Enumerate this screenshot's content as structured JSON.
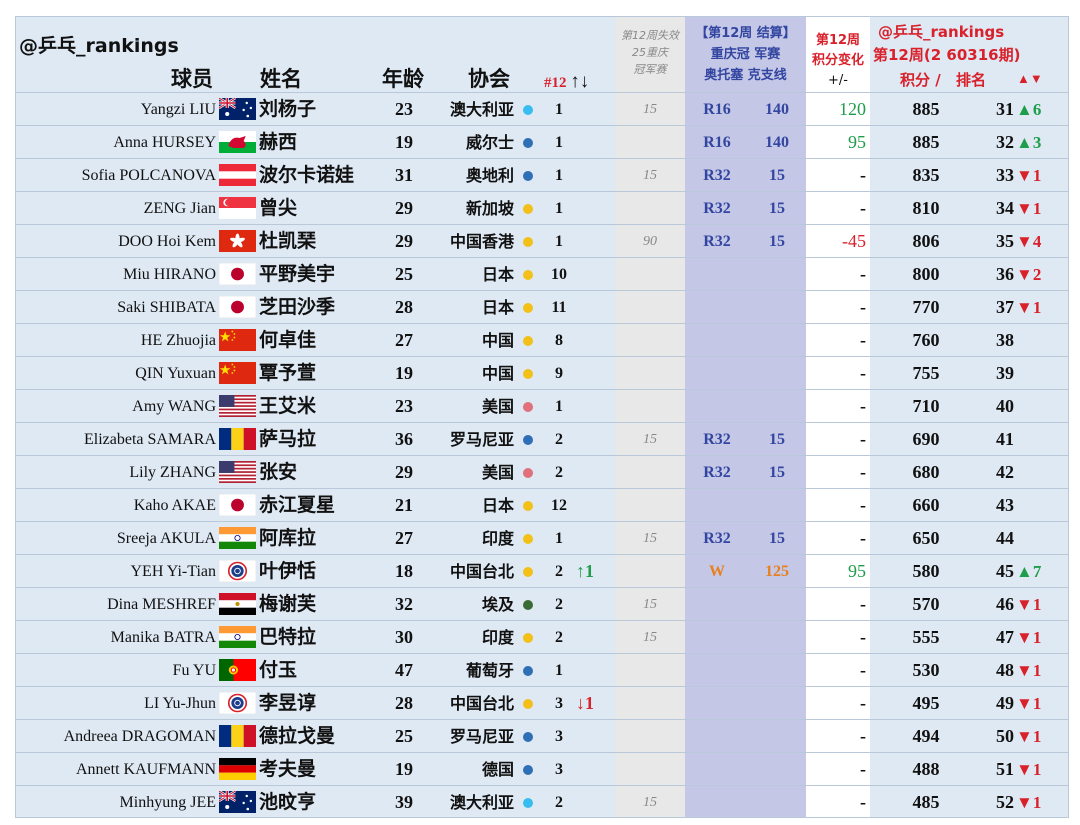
{
  "header": {
    "handle": "@乒乓_rankings",
    "col_player": "球员",
    "col_name": "姓名",
    "col_age": "年龄",
    "col_assoc": "协会",
    "col_count": "#12",
    "col_count_arrows": "↑↓",
    "lost_title": [
      "第12周失效",
      "25重庆",
      "冠军赛"
    ],
    "event_title": [
      "【第12周 结算】",
      "重庆冠 军赛",
      "奥托塞 克支线"
    ],
    "change_title": [
      "第12周",
      "积分变化",
      "+/-"
    ],
    "ranking_handle": "@乒乓_rankings",
    "ranking_week": "第12周(2 60316期)",
    "ranking_points": "积分 /",
    "ranking_rank": "排名",
    "ranking_arrows": "▲▼"
  },
  "colors": {
    "background": "#dfe9f4",
    "lost_column": "#e8e8e8",
    "event_column": "#c4c7e6",
    "change_column": "#ffffff",
    "up": "#1e9e4a",
    "down": "#d8212b",
    "event_text": "#3245a0",
    "winner_text": "#e87f1f"
  },
  "rows": [
    {
      "en": "Yangzi LIU",
      "flag": "australia",
      "cn": "刘杨子",
      "age": "23",
      "assoc": "澳大利亚",
      "dot": "#38bdf0",
      "count": "1",
      "arrow": "",
      "arrow_dir": "",
      "lost": "15",
      "round": "R16",
      "rpts": "140",
      "chg": "120",
      "chg_dir": "up",
      "pts": "885",
      "rank": "31",
      "mv": "▲6",
      "mv_dir": "up"
    },
    {
      "en": "Anna HURSEY",
      "flag": "wales",
      "cn": "赫西",
      "age": "19",
      "assoc": "威尔士",
      "dot": "#2f6fb5",
      "count": "1",
      "arrow": "",
      "arrow_dir": "",
      "lost": "",
      "round": "R16",
      "rpts": "140",
      "chg": "95",
      "chg_dir": "up",
      "pts": "885",
      "rank": "32",
      "mv": "▲3",
      "mv_dir": "up"
    },
    {
      "en": "Sofia POLCANOVA",
      "flag": "austria",
      "cn": "波尔卡诺娃",
      "age": "31",
      "assoc": "奥地利",
      "dot": "#2f6fb5",
      "count": "1",
      "arrow": "",
      "arrow_dir": "",
      "lost": "15",
      "round": "R32",
      "rpts": "15",
      "chg": "-",
      "chg_dir": "",
      "pts": "835",
      "rank": "33",
      "mv": "▼1",
      "mv_dir": "down"
    },
    {
      "en": "ZENG Jian",
      "flag": "singapore",
      "cn": "曾尖",
      "age": "29",
      "assoc": "新加坡",
      "dot": "#f2c019",
      "count": "1",
      "arrow": "",
      "arrow_dir": "",
      "lost": "",
      "round": "R32",
      "rpts": "15",
      "chg": "-",
      "chg_dir": "",
      "pts": "810",
      "rank": "34",
      "mv": "▼1",
      "mv_dir": "down"
    },
    {
      "en": "DOO Hoi Kem",
      "flag": "hongkong",
      "cn": "杜凯琹",
      "age": "29",
      "assoc": "中国香港",
      "dot": "#f2c019",
      "count": "1",
      "arrow": "",
      "arrow_dir": "",
      "lost": "90",
      "round": "R32",
      "rpts": "15",
      "chg": "-45",
      "chg_dir": "down",
      "pts": "806",
      "rank": "35",
      "mv": "▼4",
      "mv_dir": "down"
    },
    {
      "en": "Miu HIRANO",
      "flag": "japan",
      "cn": "平野美宇",
      "age": "25",
      "assoc": "日本",
      "dot": "#f2c019",
      "count": "10",
      "arrow": "",
      "arrow_dir": "",
      "lost": "",
      "round": "",
      "rpts": "",
      "chg": "-",
      "chg_dir": "",
      "pts": "800",
      "rank": "36",
      "mv": "▼2",
      "mv_dir": "down"
    },
    {
      "en": "Saki SHIBATA",
      "flag": "japan",
      "cn": "芝田沙季",
      "age": "28",
      "assoc": "日本",
      "dot": "#f2c019",
      "count": "11",
      "arrow": "",
      "arrow_dir": "",
      "lost": "",
      "round": "",
      "rpts": "",
      "chg": "-",
      "chg_dir": "",
      "pts": "770",
      "rank": "37",
      "mv": "▼1",
      "mv_dir": "down"
    },
    {
      "en": "HE Zhuojia",
      "flag": "china",
      "cn": "何卓佳",
      "age": "27",
      "assoc": "中国",
      "dot": "#f2c019",
      "count": "8",
      "arrow": "",
      "arrow_dir": "",
      "lost": "",
      "round": "",
      "rpts": "",
      "chg": "-",
      "chg_dir": "",
      "pts": "760",
      "rank": "38",
      "mv": "",
      "mv_dir": ""
    },
    {
      "en": "QIN Yuxuan",
      "flag": "china",
      "cn": "覃予萱",
      "age": "19",
      "assoc": "中国",
      "dot": "#f2c019",
      "count": "9",
      "arrow": "",
      "arrow_dir": "",
      "lost": "",
      "round": "",
      "rpts": "",
      "chg": "-",
      "chg_dir": "",
      "pts": "755",
      "rank": "39",
      "mv": "",
      "mv_dir": ""
    },
    {
      "en": "Amy WANG",
      "flag": "usa",
      "cn": "王艾米",
      "age": "23",
      "assoc": "美国",
      "dot": "#e0707a",
      "count": "1",
      "arrow": "",
      "arrow_dir": "",
      "lost": "",
      "round": "",
      "rpts": "",
      "chg": "-",
      "chg_dir": "",
      "pts": "710",
      "rank": "40",
      "mv": "",
      "mv_dir": ""
    },
    {
      "en": "Elizabeta SAMARA",
      "flag": "romania",
      "cn": "萨马拉",
      "age": "36",
      "assoc": "罗马尼亚",
      "dot": "#2f6fb5",
      "count": "2",
      "arrow": "",
      "arrow_dir": "",
      "lost": "15",
      "round": "R32",
      "rpts": "15",
      "chg": "-",
      "chg_dir": "",
      "pts": "690",
      "rank": "41",
      "mv": "",
      "mv_dir": ""
    },
    {
      "en": "Lily ZHANG",
      "flag": "usa",
      "cn": "张安",
      "age": "29",
      "assoc": "美国",
      "dot": "#e0707a",
      "count": "2",
      "arrow": "",
      "arrow_dir": "",
      "lost": "",
      "round": "R32",
      "rpts": "15",
      "chg": "-",
      "chg_dir": "",
      "pts": "680",
      "rank": "42",
      "mv": "",
      "mv_dir": ""
    },
    {
      "en": "Kaho AKAE",
      "flag": "japan",
      "cn": "赤江夏星",
      "age": "21",
      "assoc": "日本",
      "dot": "#f2c019",
      "count": "12",
      "arrow": "",
      "arrow_dir": "",
      "lost": "",
      "round": "",
      "rpts": "",
      "chg": "-",
      "chg_dir": "",
      "pts": "660",
      "rank": "43",
      "mv": "",
      "mv_dir": ""
    },
    {
      "en": "Sreeja AKULA",
      "flag": "india",
      "cn": "阿库拉",
      "age": "27",
      "assoc": "印度",
      "dot": "#f2c019",
      "count": "1",
      "arrow": "",
      "arrow_dir": "",
      "lost": "15",
      "round": "R32",
      "rpts": "15",
      "chg": "-",
      "chg_dir": "",
      "pts": "650",
      "rank": "44",
      "mv": "",
      "mv_dir": ""
    },
    {
      "en": "YEH Yi-Tian",
      "flag": "taipei",
      "cn": "叶伊恬",
      "age": "18",
      "assoc": "中国台北",
      "dot": "#f2c019",
      "count": "2",
      "arrow": "↑1",
      "arrow_dir": "up",
      "lost": "",
      "round": "W",
      "rpts": "125",
      "chg": "95",
      "chg_dir": "up",
      "pts": "580",
      "rank": "45",
      "mv": "▲7",
      "mv_dir": "up"
    },
    {
      "en": "Dina MESHREF",
      "flag": "egypt",
      "cn": "梅谢芙",
      "age": "32",
      "assoc": "埃及",
      "dot": "#3a6b35",
      "count": "2",
      "arrow": "",
      "arrow_dir": "",
      "lost": "15",
      "round": "",
      "rpts": "",
      "chg": "-",
      "chg_dir": "",
      "pts": "570",
      "rank": "46",
      "mv": "▼1",
      "mv_dir": "down"
    },
    {
      "en": "Manika BATRA",
      "flag": "india",
      "cn": "巴特拉",
      "age": "30",
      "assoc": "印度",
      "dot": "#f2c019",
      "count": "2",
      "arrow": "",
      "arrow_dir": "",
      "lost": "15",
      "round": "",
      "rpts": "",
      "chg": "-",
      "chg_dir": "",
      "pts": "555",
      "rank": "47",
      "mv": "▼1",
      "mv_dir": "down"
    },
    {
      "en": "Fu YU",
      "flag": "portugal",
      "cn": "付玉",
      "age": "47",
      "assoc": "葡萄牙",
      "dot": "#2f6fb5",
      "count": "1",
      "arrow": "",
      "arrow_dir": "",
      "lost": "",
      "round": "",
      "rpts": "",
      "chg": "-",
      "chg_dir": "",
      "pts": "530",
      "rank": "48",
      "mv": "▼1",
      "mv_dir": "down"
    },
    {
      "en": "LI Yu-Jhun",
      "flag": "taipei",
      "cn": "李昱谆",
      "age": "28",
      "assoc": "中国台北",
      "dot": "#f2c019",
      "count": "3",
      "arrow": "↓1",
      "arrow_dir": "down",
      "lost": "",
      "round": "",
      "rpts": "",
      "chg": "-",
      "chg_dir": "",
      "pts": "495",
      "rank": "49",
      "mv": "▼1",
      "mv_dir": "down"
    },
    {
      "en": "Andreea DRAGOMAN",
      "flag": "romania",
      "cn": "德拉戈曼",
      "age": "25",
      "assoc": "罗马尼亚",
      "dot": "#2f6fb5",
      "count": "3",
      "arrow": "",
      "arrow_dir": "",
      "lost": "",
      "round": "",
      "rpts": "",
      "chg": "-",
      "chg_dir": "",
      "pts": "494",
      "rank": "50",
      "mv": "▼1",
      "mv_dir": "down"
    },
    {
      "en": "Annett KAUFMANN",
      "flag": "germany",
      "cn": "考夫曼",
      "age": "19",
      "assoc": "德国",
      "dot": "#2f6fb5",
      "count": "3",
      "arrow": "",
      "arrow_dir": "",
      "lost": "",
      "round": "",
      "rpts": "",
      "chg": "-",
      "chg_dir": "",
      "pts": "488",
      "rank": "51",
      "mv": "▼1",
      "mv_dir": "down"
    },
    {
      "en": "Minhyung JEE",
      "flag": "australia",
      "cn": "池旼亨",
      "age": "39",
      "assoc": "澳大利亚",
      "dot": "#38bdf0",
      "count": "2",
      "arrow": "",
      "arrow_dir": "",
      "lost": "15",
      "round": "",
      "rpts": "",
      "chg": "-",
      "chg_dir": "",
      "pts": "485",
      "rank": "52",
      "mv": "▼1",
      "mv_dir": "down"
    }
  ]
}
